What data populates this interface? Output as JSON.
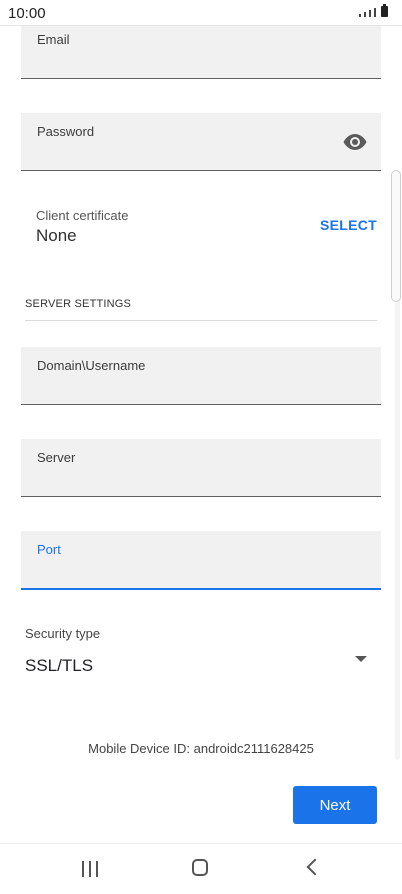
{
  "status_bar": {
    "time": "10:00"
  },
  "form": {
    "email_label": "Email",
    "password_label": "Password",
    "client_certificate_label": "Client certificate",
    "client_certificate_value": "None",
    "select_label": "SELECT",
    "server_settings_header": "SERVER SETTINGS",
    "domain_username_label": "Domain\\Username",
    "server_label": "Server",
    "port_label": "Port",
    "security_type_label": "Security type",
    "security_type_value": "SSL/TLS",
    "device_id_text": "Mobile Device ID: androidc2111628425",
    "next_label": "Next"
  },
  "icons": {
    "password_toggle": "eye-icon",
    "security_dropdown": "caret-down-icon",
    "nav_recents": "recents-icon",
    "nav_home": "home-icon",
    "nav_back": "back-icon"
  },
  "colors": {
    "accent": "#1a73e8",
    "field_bg": "#f1f1f1"
  }
}
